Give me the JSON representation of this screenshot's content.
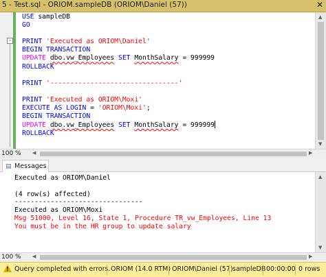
{
  "window": {
    "title": "5 - Test.sql - ORIOM.sampleDB (ORIOM\\Daniel (57))",
    "close_glyph": "✕"
  },
  "editor": {
    "line1_kw": "USE",
    "line1_db": "sampleDB",
    "line2": "GO",
    "print1_kw": "PRINT",
    "print1_str": "'Executed as ORIOM\\Daniel'",
    "begin1": "BEGIN TRANSACTION",
    "update1_kw": "UPDATE",
    "update1_obj": "dbo.vw_Employees",
    "update1_set": "SET",
    "update1_col": "MonthSalary",
    "update1_val": "= 999999",
    "rollback1": "ROLLBACK",
    "print2_kw": "PRINT",
    "print2_str": "'--------------------------------'",
    "print3_kw": "PRINT",
    "print3_str": "'Executed as ORIOM\\Moxi'",
    "execute_kw": "EXECUTE AS LOGIN",
    "execute_eq": "=",
    "execute_str": "'ORIOM\\Moxi'",
    "execute_semi": ";",
    "begin2": "BEGIN TRANSACTION",
    "update2_kw": "UPDATE",
    "update2_obj": "dbo.vw_Employees",
    "update2_set": "SET",
    "update2_col": "MonthSalary",
    "update2_val": "= 999999",
    "rollback2": "ROLLBACK",
    "zoom": "100 %"
  },
  "results": {
    "tab_label": "Messages",
    "lines": [
      "Executed as ORIOM\\Daniel",
      "",
      "(4 row(s) affected)",
      "--------------------------------",
      "Executed as ORIOM\\Moxi"
    ],
    "error_lines": [
      "Msg 51000, Level 16, State 1, Procedure TR_vw_Employees, Line 13",
      "You must be in the HR group to update salary"
    ],
    "zoom": "100 %"
  },
  "status": {
    "message": "Query completed with errors.",
    "server": "ORIOM (14.0 RTM)",
    "login": "ORIOM\\Daniel (57)",
    "database": "sampleDB",
    "elapsed": "00:00:00",
    "rows": "0 rows"
  },
  "colors": {
    "title_bar": "#d7c16a",
    "status_bar": "#ffee99",
    "keyword": "#0000ff",
    "string": "#ff0000",
    "update_keyword": "#ff00ff",
    "change_bar": "#63b15a"
  }
}
